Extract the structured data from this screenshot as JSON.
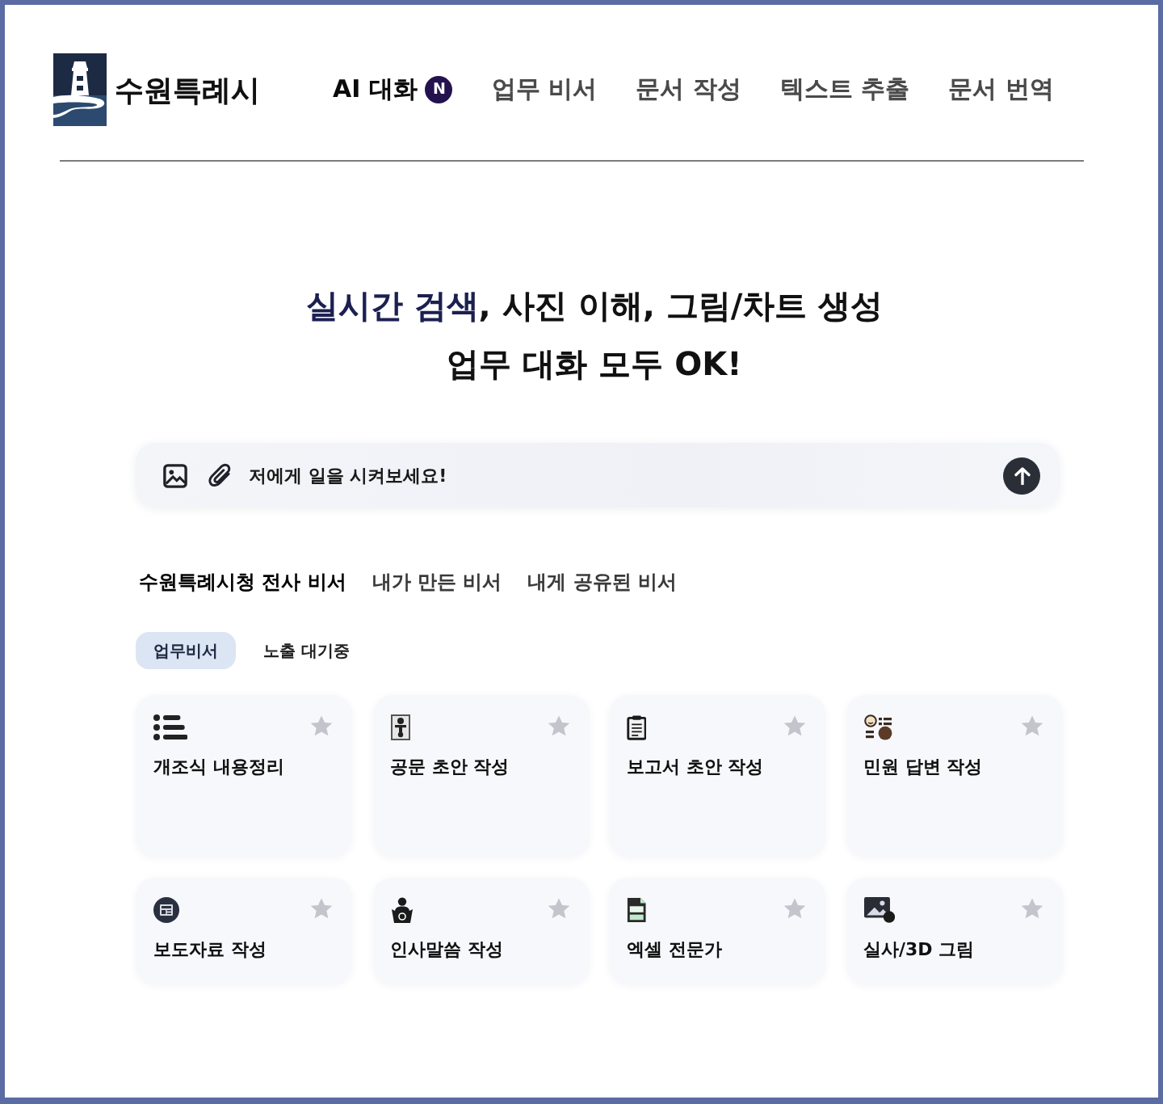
{
  "header": {
    "brand": "수원특례시",
    "nav": [
      {
        "label": "AI 대화",
        "selected": true,
        "badge": "N"
      },
      {
        "label": "업무 비서",
        "selected": false
      },
      {
        "label": "문서 작성",
        "selected": false
      },
      {
        "label": "텍스트 추출",
        "selected": false
      },
      {
        "label": "문서 번역",
        "selected": false
      }
    ]
  },
  "hero": {
    "lines": [
      "**실시간 검색**, 사진 이해, 그림/차트 생성",
      "업무 대화 모두 OK!"
    ]
  },
  "prompt": {
    "placeholder": "저에게 일을 시켜보세요!"
  },
  "assistant_tabs": [
    {
      "label": "수원특례시청 전사 비서",
      "selected": true
    },
    {
      "label": "내가 만든 비서",
      "selected": false
    },
    {
      "label": "내게 공유된 비서",
      "selected": false
    }
  ],
  "filters": [
    {
      "label": "업무비서",
      "selected": true
    },
    {
      "label": "노출 대기중",
      "selected": false
    }
  ],
  "cards": [
    {
      "title": "개조식 내용정리",
      "starred": false
    },
    {
      "title": "공문 초안 작성",
      "starred": false
    },
    {
      "title": "보고서 초안 작성",
      "starred": false
    },
    {
      "title": "민원 답변 작성",
      "starred": false
    },
    {
      "title": "보도자료 작성",
      "starred": false
    },
    {
      "title": "인사말씀 작성",
      "starred": false
    },
    {
      "title": "엑셀 전문가",
      "starred": false
    },
    {
      "title": "실사/3D 그림",
      "starred": false
    }
  ]
}
